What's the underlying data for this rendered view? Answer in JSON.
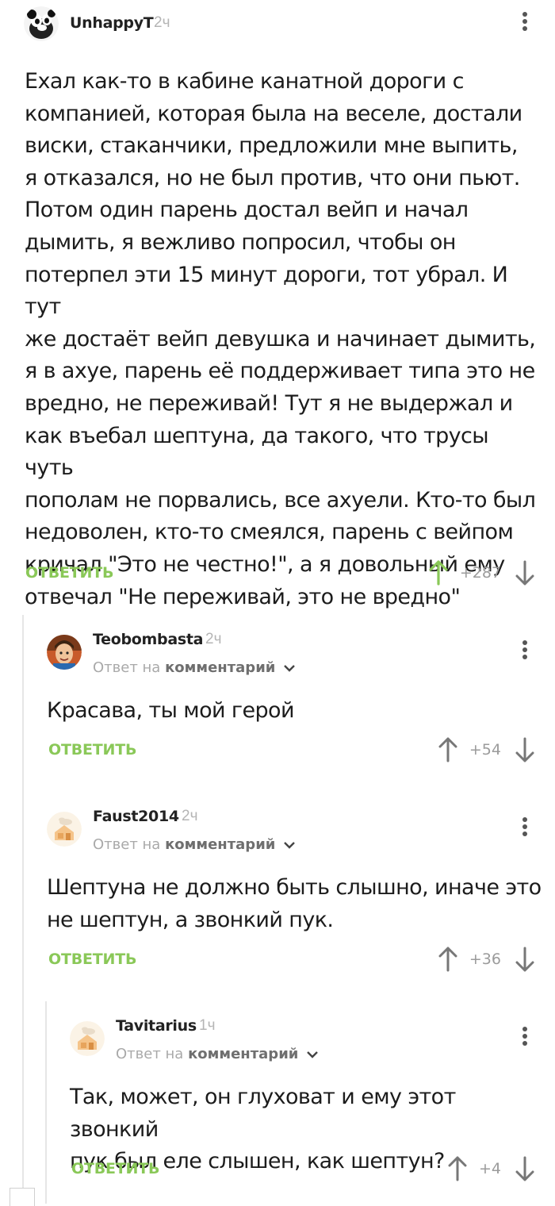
{
  "comments": [
    {
      "author": "UnhappyT",
      "time": "2ч",
      "text": "Ехал как-то в кабине канатной дороги с\nкомпанией, которая была на веселе, достали\nвиски, стаканчики, предложили мне выпить,\nя отказался, но не был против, что они пьют.\nПотом один парень достал вейп и начал\nдымить, я вежливо попросил, чтобы он\nпотерпел эти 15 минут дороги, тот убрал. И тут\nже достаёт вейп девушка и начинает дымить,\nя в ахуе, парень её поддерживает типа это не\nвредно, не переживай! Тут я не выдержал и\nкак въебал шептуна, да такого, что трусы чуть\nпополам не порвались, все ахуели. Кто-то был\nнедоволен, кто-то смеялся, парень с вейпом\nкричал \"Это не честно!\", а я довольный ему\nотвечал \"Не переживай, это не вредно\"",
      "reply_label": "ОТВЕТИТЬ",
      "rating": "+287",
      "upvoted": true
    },
    {
      "author": "Teobombasta",
      "time": "2ч",
      "reply_to_prefix": "Ответ на",
      "reply_to_link": "комментарий",
      "text": "Красава, ты мой герой",
      "reply_label": "ОТВЕТИТЬ",
      "rating": "+54"
    },
    {
      "author": "Faust2014",
      "time": "2ч",
      "reply_to_prefix": "Ответ на",
      "reply_to_link": "комментарий",
      "text": "Шептуна не должно быть слышно, иначе это\nне шептун, а звонкий пук.",
      "reply_label": "ОТВЕТИТЬ",
      "rating": "+36"
    },
    {
      "author": "Tavitarius",
      "time": "1ч",
      "reply_to_prefix": "Ответ на",
      "reply_to_link": "комментарий",
      "text": "Так, может, он глуховат и ему этот звонкий\nпук был еле слышен, как шептун?",
      "reply_label": "ОТВЕТИТЬ",
      "rating": "+4"
    }
  ],
  "colors": {
    "accent_green": "#8ac858",
    "upvote_active": "#8ac858",
    "muted": "#9b9b9b"
  }
}
